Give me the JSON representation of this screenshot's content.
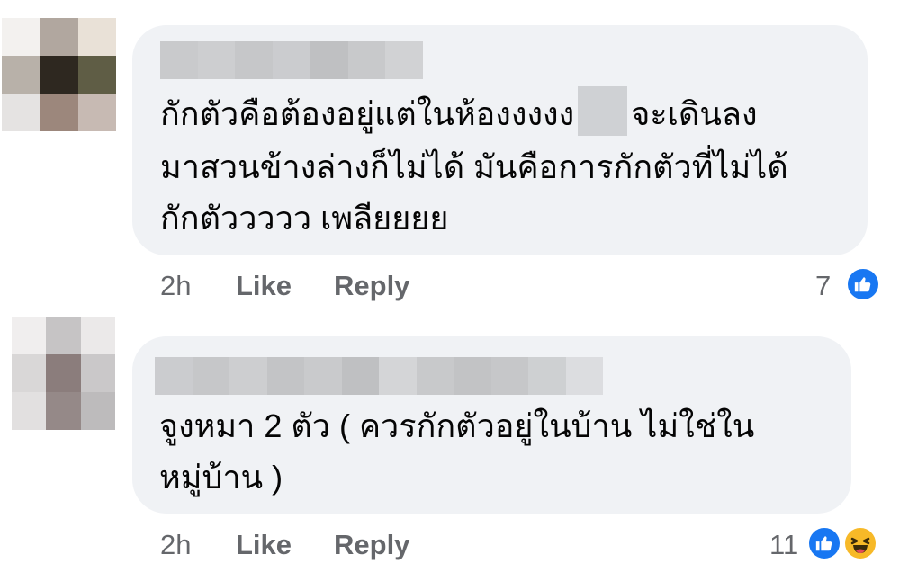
{
  "colors": {
    "bubble_bg": "#f0f2f5",
    "meta_text": "#65676b",
    "like_blue": "#1877f2",
    "haha_yellow": "#f7b928"
  },
  "comments": [
    {
      "avatar_icon": "pixelated-avatar-icon",
      "text_line_1a": "กักตัวคือต้องอยู่แต่ในห้องงงงง",
      "text_line_1b": "จะเดินลง",
      "text_line_2": "มาสวนข้างล่างก็ไม่ได้ มันคือการกักตัวที่ไม่ได้",
      "text_line_3": "กักตัววววว เพลียยยย",
      "time": "2h",
      "like_label": "Like",
      "reply_label": "Reply",
      "reaction_count": "7",
      "reactions": [
        "like-icon"
      ]
    },
    {
      "avatar_icon": "pixelated-avatar-icon",
      "text_line_1": "จูงหมา 2 ตัว ( ควรกักตัวอยู่ในบ้าน ไม่ใช่ใน",
      "text_line_2": "หมู่บ้าน )",
      "time": "2h",
      "like_label": "Like",
      "reply_label": "Reply",
      "reaction_count": "11",
      "reactions": [
        "like-icon",
        "haha-icon"
      ]
    }
  ]
}
